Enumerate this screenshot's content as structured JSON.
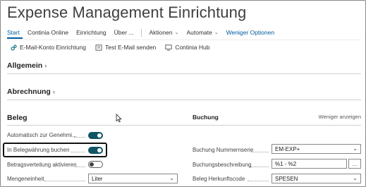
{
  "page": {
    "title": "Expense Management Einrichtung"
  },
  "menu": {
    "items": [
      "Start",
      "Continia Online",
      "Einrichtung",
      "Über ..."
    ],
    "aktionen": "Aktionen",
    "automate": "Automate",
    "weniger": "Weniger Optionen",
    "active_color": "#005a9e"
  },
  "actions": {
    "email_konto": "E-Mail-Konto Einrichtung",
    "test_email": "Test E-Mail senden",
    "continia_hub": "Continia Hub"
  },
  "sections": {
    "allgemein": "Allgemein",
    "abrechnung": "Abrechnung",
    "beleg": "Beleg",
    "weniger_anzeigen": "Weniger anzeigen"
  },
  "beleg": {
    "left": {
      "auto_genehmigung": {
        "label": "Automatisch zur Genehmi...",
        "on": true
      },
      "belegwaehrung": {
        "label": "In Belegwährung buchen",
        "on": true
      },
      "betragsverteilung": {
        "label": "Betragsverteilung aktivieren",
        "on": false
      },
      "mengeneinheit": {
        "label": "Mengeneinheit",
        "value": "Liter"
      }
    },
    "right": {
      "heading": "Buchung",
      "nummernserie": {
        "label": "Buchung Nummernserie",
        "value": "EM-EXP+"
      },
      "buchungsbeschreibung": {
        "label": "Buchungsbeschreibung",
        "value": "%1 - %2",
        "ellipsis": "..."
      },
      "herkunftscode": {
        "label": "Beleg Herkunftscode",
        "value": "SPESEN"
      }
    },
    "toggle_on_color": "#0f5566"
  }
}
